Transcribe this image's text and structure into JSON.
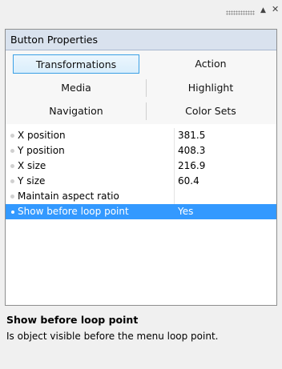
{
  "window": {
    "pin_icon": "pin-icon",
    "close_icon": "close-icon"
  },
  "panel": {
    "title": "Button Properties"
  },
  "tabs": [
    {
      "label": "Transformations",
      "selected": true
    },
    {
      "label": "Action",
      "selected": false
    },
    {
      "label": "Media",
      "selected": false
    },
    {
      "label": "Highlight",
      "selected": false
    },
    {
      "label": "Navigation",
      "selected": false
    },
    {
      "label": "Color Sets",
      "selected": false
    }
  ],
  "properties": [
    {
      "name": "X position",
      "value": "381.5"
    },
    {
      "name": "Y position",
      "value": "408.3"
    },
    {
      "name": "X size",
      "value": "216.9"
    },
    {
      "name": "Y size",
      "value": "60.4"
    },
    {
      "name": "Maintain aspect ratio",
      "value": ""
    },
    {
      "name": "Show before loop point",
      "value": "Yes",
      "selected": true
    }
  ],
  "description": {
    "title": "Show before loop point",
    "text": "Is object visible before the menu loop point."
  },
  "colors": {
    "selection": "#3399ff",
    "header_bg": "#d9e2ee",
    "selected_tab_border": "#3aa0e6"
  }
}
